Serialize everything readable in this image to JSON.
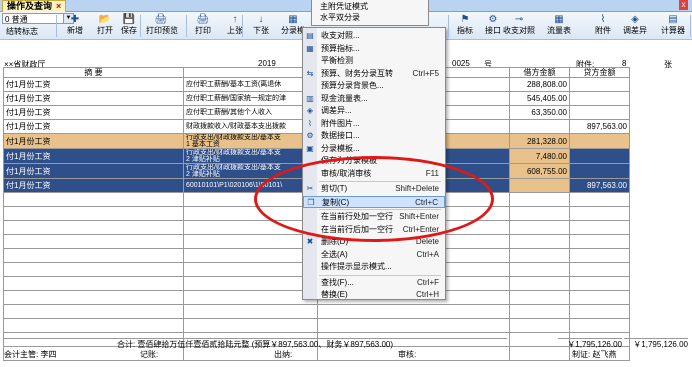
{
  "tab": {
    "title": "操作及查询",
    "close": "×"
  },
  "toolbar": {
    "combo_value": "0 普通",
    "combo_sub": "结转标志",
    "left_buttons": [
      "新增",
      "打开",
      "保存",
      "打印预览",
      "打印",
      "上张",
      "下张",
      "分录模"
    ],
    "right_buttons": [
      "指标",
      "接口",
      "收支对照",
      "流量表",
      "附件",
      "调差异",
      "计算器"
    ],
    "right_icons": [
      "flag-icon",
      "gear-icon",
      "link-icon",
      "table-icon",
      "paperclip-icon",
      "adjust-icon",
      "calculator-icon"
    ]
  },
  "voucher": {
    "unit": "××省财政厅",
    "year": "2019",
    "number_prefix": "0025",
    "number_suffix": "号",
    "attach_label": "附件:",
    "attach_count": "8",
    "attach_unit": "张",
    "headers": {
      "summary": "摘    要",
      "account": "",
      "debit": "借方金额",
      "credit": "贷方金额"
    },
    "rows": [
      {
        "summary": "付1月份工资",
        "account": "应付职工薪酬/基本工资(离退休",
        "extra": "",
        "debit": "288,808.00",
        "credit": "",
        "style": ""
      },
      {
        "summary": "付1月份工资",
        "account": "应付职工薪酬/国家统一规定的津",
        "extra": "",
        "debit": "545,405.00",
        "credit": "",
        "style": ""
      },
      {
        "summary": "付1月份工资",
        "account": "应付职工薪酬/其他个人收入",
        "extra": "",
        "debit": "63,350.00",
        "credit": "",
        "style": ""
      },
      {
        "summary": "付1月份工资",
        "account": "财政拨款收入/财政基本支出拨款",
        "extra": "",
        "debit": "",
        "credit": "897,563.00",
        "style": ""
      },
      {
        "summary": "付1月份工资",
        "account": "行政支出/财政拨款支出/基本支\n1 基本工资",
        "extra": "0601 行政运行//3010",
        "debit": "281,328.00",
        "credit": "",
        "style": "orange"
      },
      {
        "summary": "付1月份工资",
        "account": "行政支出/财政拨款支出/基本支\n2 津贴补贴",
        "extra": "0601 行政运行//3010",
        "debit": "7,480.00",
        "credit": "",
        "style": "sel"
      },
      {
        "summary": "付1月份工资",
        "account": "行政支出/财政拨款支出/基本支\n2 津贴补贴",
        "extra": "0601 行政运行//3010",
        "debit": "608,755.00",
        "credit": "",
        "style": "sel"
      },
      {
        "summary": "付1月份工资",
        "account": "60010101\\P1\\020106\\1\\50101\\",
        "extra": "",
        "debit": "",
        "credit": "897,563.00",
        "style": "sel"
      }
    ],
    "total_label": "合计: 壹佰肆拾万伍仟壹佰贰拾陆元整 (预算￥897,563.00、财务￥897,563.00)",
    "total_debit": "￥1,795,126.00",
    "total_credit": "￥1,795,126.00",
    "signatures": {
      "supervisor": "会计主管: 李四",
      "bookkeeper": "记账:",
      "cashier": "出纳:",
      "auditor": "审核:",
      "preparer": "制证: 赵飞燕"
    }
  },
  "menu_top": [
    "主附凭证模式",
    "水平双分录"
  ],
  "menu": [
    {
      "label": "收支对照...",
      "key": "",
      "icon": "compare-icon",
      "sep_before": false
    },
    {
      "label": "预算指标...",
      "key": "",
      "icon": "budget-icon",
      "sep_before": false
    },
    {
      "label": "平衡检测",
      "key": "",
      "icon": "",
      "sep_before": false
    },
    {
      "label": "预算、财务分录互转",
      "key": "Ctrl+F5",
      "icon": "convert-icon",
      "sep_before": false
    },
    {
      "label": "预算分录背景色...",
      "key": "",
      "icon": "",
      "sep_before": false
    },
    {
      "label": "现金流量表...",
      "key": "",
      "icon": "cashflow-icon",
      "sep_before": false
    },
    {
      "label": "调差异...",
      "key": "",
      "icon": "adjust-icon",
      "sep_before": false
    },
    {
      "label": "附件图片...",
      "key": "",
      "icon": "paperclip-icon",
      "sep_before": false
    },
    {
      "label": "数据接口...",
      "key": "",
      "icon": "interface-icon",
      "sep_before": false
    },
    {
      "label": "分录模板...",
      "key": "",
      "icon": "template-icon",
      "sep_before": false
    },
    {
      "label": "保存为分录模板",
      "key": "",
      "icon": "",
      "sep_before": false
    },
    {
      "label": "审核/取消审核",
      "key": "F11",
      "icon": "",
      "sep_before": false
    },
    {
      "label": "剪切(T)",
      "key": "Shift+Delete",
      "icon": "scissors-icon",
      "sep_before": true
    },
    {
      "label": "复制(C)",
      "key": "Ctrl+C",
      "icon": "copy-icon",
      "sep_before": false,
      "hi": true
    },
    {
      "label": "在当前行处加一空行",
      "key": "Shift+Enter",
      "icon": "",
      "sep_before": true
    },
    {
      "label": "在当前行后加一空行",
      "key": "Ctrl+Enter",
      "icon": "",
      "sep_before": false
    },
    {
      "label": "删除(D)",
      "key": "Delete",
      "icon": "delete-icon",
      "sep_before": false
    },
    {
      "label": "全选(A)",
      "key": "Ctrl+A",
      "icon": "",
      "sep_before": false
    },
    {
      "label": "操作提示显示模式...",
      "key": "",
      "icon": "",
      "sep_before": false
    },
    {
      "label": "查找(F)...",
      "key": "Ctrl+F",
      "icon": "",
      "sep_before": true
    },
    {
      "label": "替换(E)",
      "key": "Ctrl+H",
      "icon": "",
      "sep_before": false
    }
  ],
  "icon_glyphs": {
    "compare-icon": "▤",
    "budget-icon": "▦",
    "convert-icon": "⇆",
    "cashflow-icon": "▥",
    "adjust-icon": "◈",
    "paperclip-icon": "⌇",
    "interface-icon": "⚙",
    "template-icon": "▣",
    "scissors-icon": "✂",
    "copy-icon": "❐",
    "delete-icon": "✖",
    "flag-icon": "⚑",
    "gear-icon": "⚙",
    "link-icon": "⊸",
    "table-icon": "▦",
    "calculator-icon": "▤"
  }
}
